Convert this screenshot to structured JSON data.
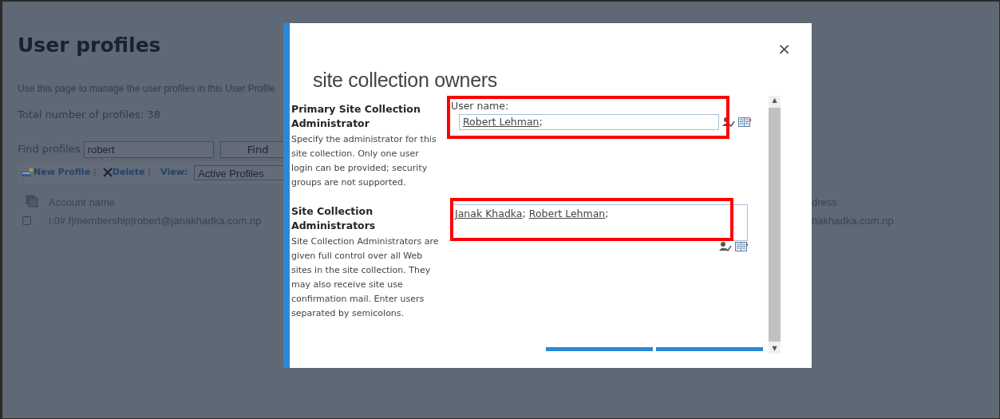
{
  "page": {
    "title": "User profiles",
    "description": "Use this page to manage the user profiles in this User Profile",
    "total": "Total number of profiles: 38",
    "find": {
      "label": "Find profiles",
      "value": "robert",
      "button": "Find"
    },
    "toolbar": {
      "new": "New Profile",
      "separator_1": "|",
      "delete": "Delete",
      "separator_2": "|",
      "view_label": "View:",
      "view_value": "Active Profiles"
    },
    "table": {
      "columns": [
        "Account name",
        "dress"
      ],
      "rows": [
        {
          "checked": false,
          "cells": [
            "i:0#.f|membership|robert@janakhadka.com.np",
            "nakhadka.com.np"
          ]
        }
      ]
    }
  },
  "dialog": {
    "title": "site collection owners",
    "close": "×",
    "scroll_up": "▲",
    "scroll_down": "▼",
    "sections": [
      {
        "kind": "single",
        "heading": "Primary Site Collection Administrator",
        "description": "Specify the administrator for this site collection. Only one user login can be provided; security groups are not supported.",
        "field_label": "User name:",
        "highlighted": true,
        "entries": [
          {
            "name": "Robert Lehman",
            "separator": ";"
          }
        ]
      },
      {
        "kind": "multi",
        "heading": "Site Collection Administrators",
        "description": "Site Collection Administrators are given full control over all Web sites in the site collection. They may also receive site use confirmation mail. Enter users separated by semicolons.",
        "highlighted": true,
        "entries": [
          {
            "name": "Janak Khadka",
            "separator": ";"
          },
          {
            "name": "Robert Lehman",
            "separator": ";"
          }
        ]
      }
    ]
  }
}
